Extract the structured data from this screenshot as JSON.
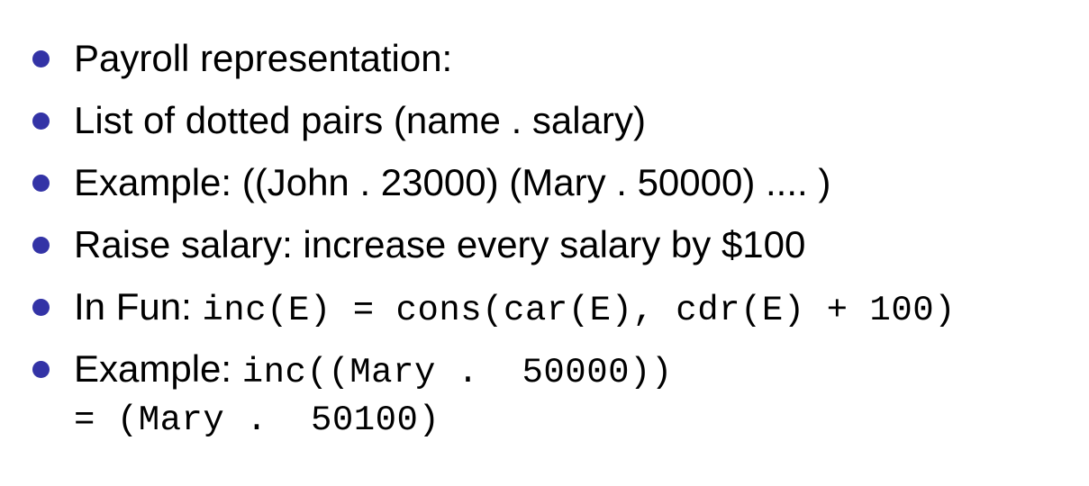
{
  "bullets": [
    {
      "text": "Payroll representation:"
    },
    {
      "text": "List of dotted pairs (name . salary)"
    },
    {
      "text": "Example: ((John . 23000) (Mary . 50000) .... )"
    },
    {
      "text": "Raise salary: increase every salary by $100"
    },
    {
      "text": "In Fun: ",
      "code": "inc(E) = cons(car(E), cdr(E) + 100)"
    },
    {
      "text": "Example: ",
      "code": "inc((Mary .  50000))"
    }
  ],
  "continuation": "= (Mary .  50100)",
  "colors": {
    "bullet": "#3333a6",
    "text": "#000000",
    "background": "#ffffff"
  }
}
